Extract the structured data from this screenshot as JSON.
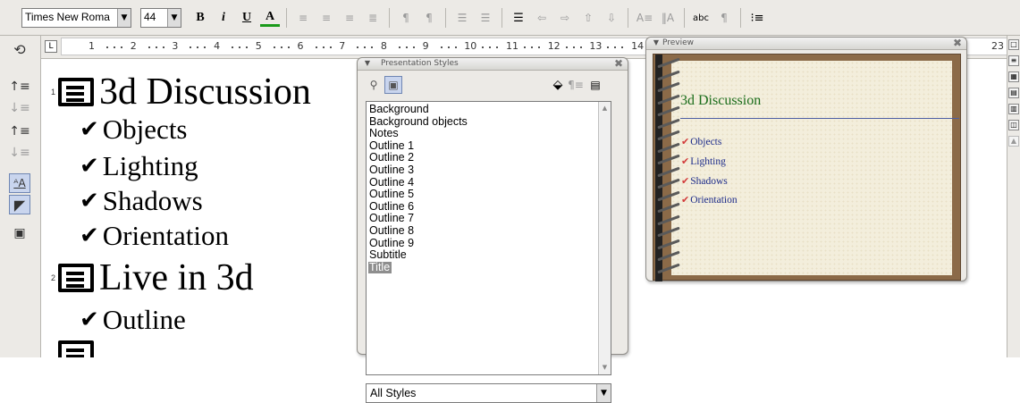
{
  "toolbar": {
    "font_name": "Times New Roma",
    "font_size": "44",
    "bold_label": "B",
    "italic_label": "i",
    "underline_label": "U",
    "font_color_label": "A"
  },
  "ruler": {
    "numbers": [
      "1",
      "2",
      "3",
      "4",
      "5",
      "6",
      "7",
      "8",
      "9",
      "10",
      "11",
      "12",
      "13",
      "14",
      "23"
    ]
  },
  "outline": {
    "slides": [
      {
        "number": "1",
        "title": "3d Discussion",
        "bullets": [
          "Objects",
          "Lighting",
          "Shadows",
          "Orientation"
        ]
      },
      {
        "number": "2",
        "title": "Live in 3d",
        "bullets": [
          "Outline"
        ]
      }
    ],
    "check_glyph": "✔"
  },
  "styles_window": {
    "title": "Presentation Styles",
    "items": [
      "Background",
      "Background objects",
      "Notes",
      "Outline 1",
      "Outline 2",
      "Outline 3",
      "Outline 4",
      "Outline 5",
      "Outline 6",
      "Outline 7",
      "Outline 8",
      "Outline 9",
      "Subtitle",
      "Title"
    ],
    "selected": "Title",
    "filter": "All Styles"
  },
  "preview_window": {
    "title": "Preview",
    "slide_title": "3d Discussion",
    "bullets": [
      "Objects",
      "Lighting",
      "Shadows",
      "Orientation"
    ],
    "colors": {
      "title": "#1b6d1b",
      "bullet_text": "#1c2b8a",
      "check": "#d23a3a",
      "frame": "#8b6a48",
      "paper": "#f3eedc"
    }
  }
}
